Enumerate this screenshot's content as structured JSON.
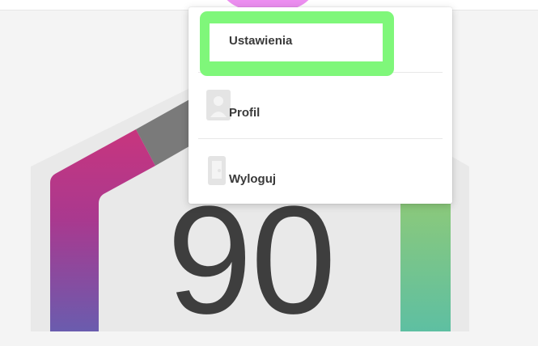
{
  "score": {
    "value": "90"
  },
  "menu": {
    "items": [
      {
        "label": "Ustawienia",
        "icon": "gear-icon"
      },
      {
        "label": "Profil",
        "icon": "user-icon"
      },
      {
        "label": "Wyloguj",
        "icon": "logout-icon"
      }
    ]
  },
  "colors": {
    "highlight": "#7ff77a",
    "pink_indicator": "#ec8ef0",
    "gauge_magenta": "#c8357e",
    "gauge_purple": "#6a5cae",
    "gauge_green": "#8bc97b",
    "gauge_teal": "#5ebfa2",
    "gauge_gray": "#7a7a7a"
  }
}
